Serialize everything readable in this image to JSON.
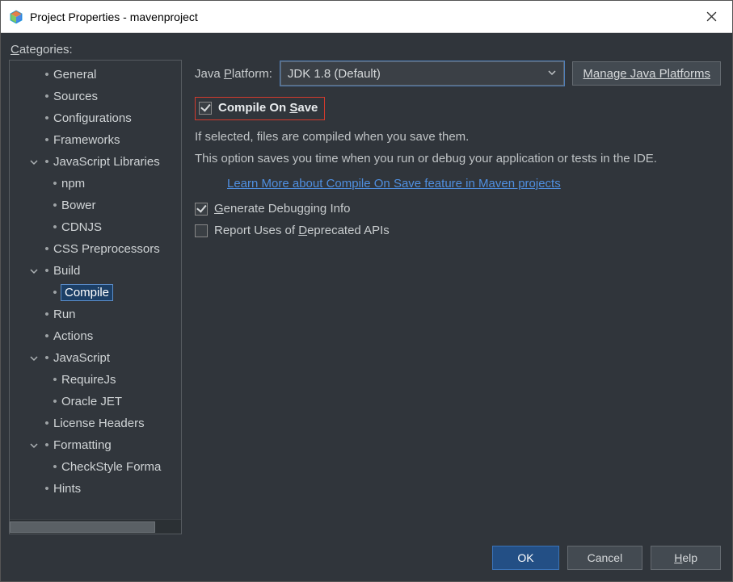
{
  "window": {
    "title": "Project Properties - mavenproject"
  },
  "categories_label_pre": "C",
  "categories_label_rest": "ategories:",
  "tree": [
    {
      "level": 1,
      "exp": "",
      "label": "General"
    },
    {
      "level": 1,
      "exp": "",
      "label": "Sources"
    },
    {
      "level": 1,
      "exp": "",
      "label": "Configurations"
    },
    {
      "level": 1,
      "exp": "",
      "label": "Frameworks"
    },
    {
      "level": 1,
      "exp": "down",
      "label": "JavaScript Libraries"
    },
    {
      "level": 2,
      "exp": "",
      "label": "npm"
    },
    {
      "level": 2,
      "exp": "",
      "label": "Bower"
    },
    {
      "level": 2,
      "exp": "",
      "label": "CDNJS"
    },
    {
      "level": 1,
      "exp": "",
      "label": "CSS Preprocessors"
    },
    {
      "level": 1,
      "exp": "down",
      "label": "Build"
    },
    {
      "level": 2,
      "exp": "",
      "label": "Compile",
      "selected": true
    },
    {
      "level": 1,
      "exp": "",
      "label": "Run"
    },
    {
      "level": 1,
      "exp": "",
      "label": "Actions"
    },
    {
      "level": 1,
      "exp": "down",
      "label": "JavaScript"
    },
    {
      "level": 2,
      "exp": "",
      "label": "RequireJs"
    },
    {
      "level": 2,
      "exp": "",
      "label": "Oracle JET"
    },
    {
      "level": 1,
      "exp": "",
      "label": "License Headers"
    },
    {
      "level": 1,
      "exp": "down",
      "label": "Formatting"
    },
    {
      "level": 2,
      "exp": "",
      "label": "CheckStyle Forma"
    },
    {
      "level": 1,
      "exp": "",
      "label": "Hints"
    }
  ],
  "platform": {
    "label_pre": "Java ",
    "label_u": "P",
    "label_post": "latform:",
    "value": "JDK 1.8 (Default)"
  },
  "manage_btn_pre": "Manage Java Platforms",
  "compile_on_save": {
    "checked": true,
    "label_pre": "Compile On ",
    "label_u": "S",
    "label_post": "ave"
  },
  "desc1": "If selected, files are compiled when you save them.",
  "desc2": "This option saves you time when you run or debug your application or tests in the IDE.",
  "link_text": "Learn More about Compile On Save feature in Maven projects",
  "gen_debug": {
    "checked": true,
    "label_u": "G",
    "label_post": "enerate Debugging Info"
  },
  "report_deprecated": {
    "checked": false,
    "label_pre": "Report Uses of ",
    "label_u": "D",
    "label_post": "eprecated APIs"
  },
  "buttons": {
    "ok": "OK",
    "cancel": "Cancel",
    "help_u": "H",
    "help_post": "elp"
  }
}
